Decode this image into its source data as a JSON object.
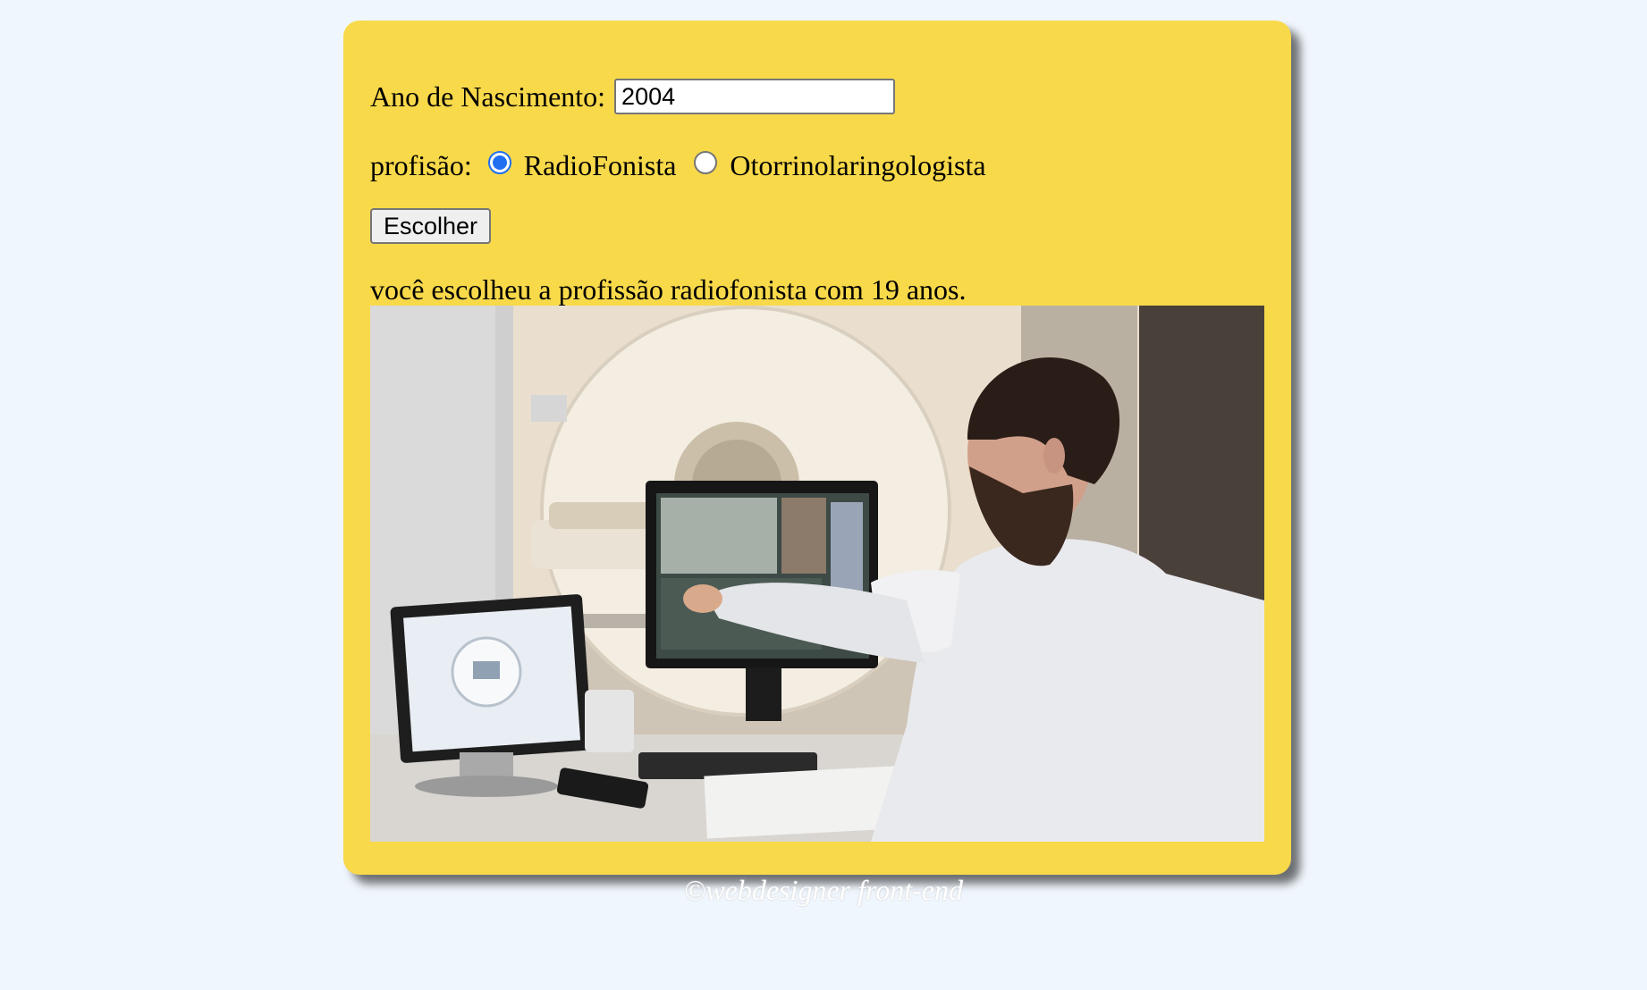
{
  "form": {
    "birth_label": "Ano de Nascimento:",
    "birth_value": "2004",
    "profession_label": "profisão:",
    "options": [
      {
        "label": "RadioFonista",
        "checked": true
      },
      {
        "label": "Otorrinolaringologista",
        "checked": false
      }
    ],
    "button_label": "Escolher"
  },
  "result": {
    "text": "você escolheu a profissão radiofonista com 19 anos."
  },
  "footer": {
    "text": "©webdesigner front-end"
  },
  "colors": {
    "page_background": "#f0f6fd",
    "card_background": "#f8d94a",
    "radio_accent": "#1f6ff0"
  }
}
